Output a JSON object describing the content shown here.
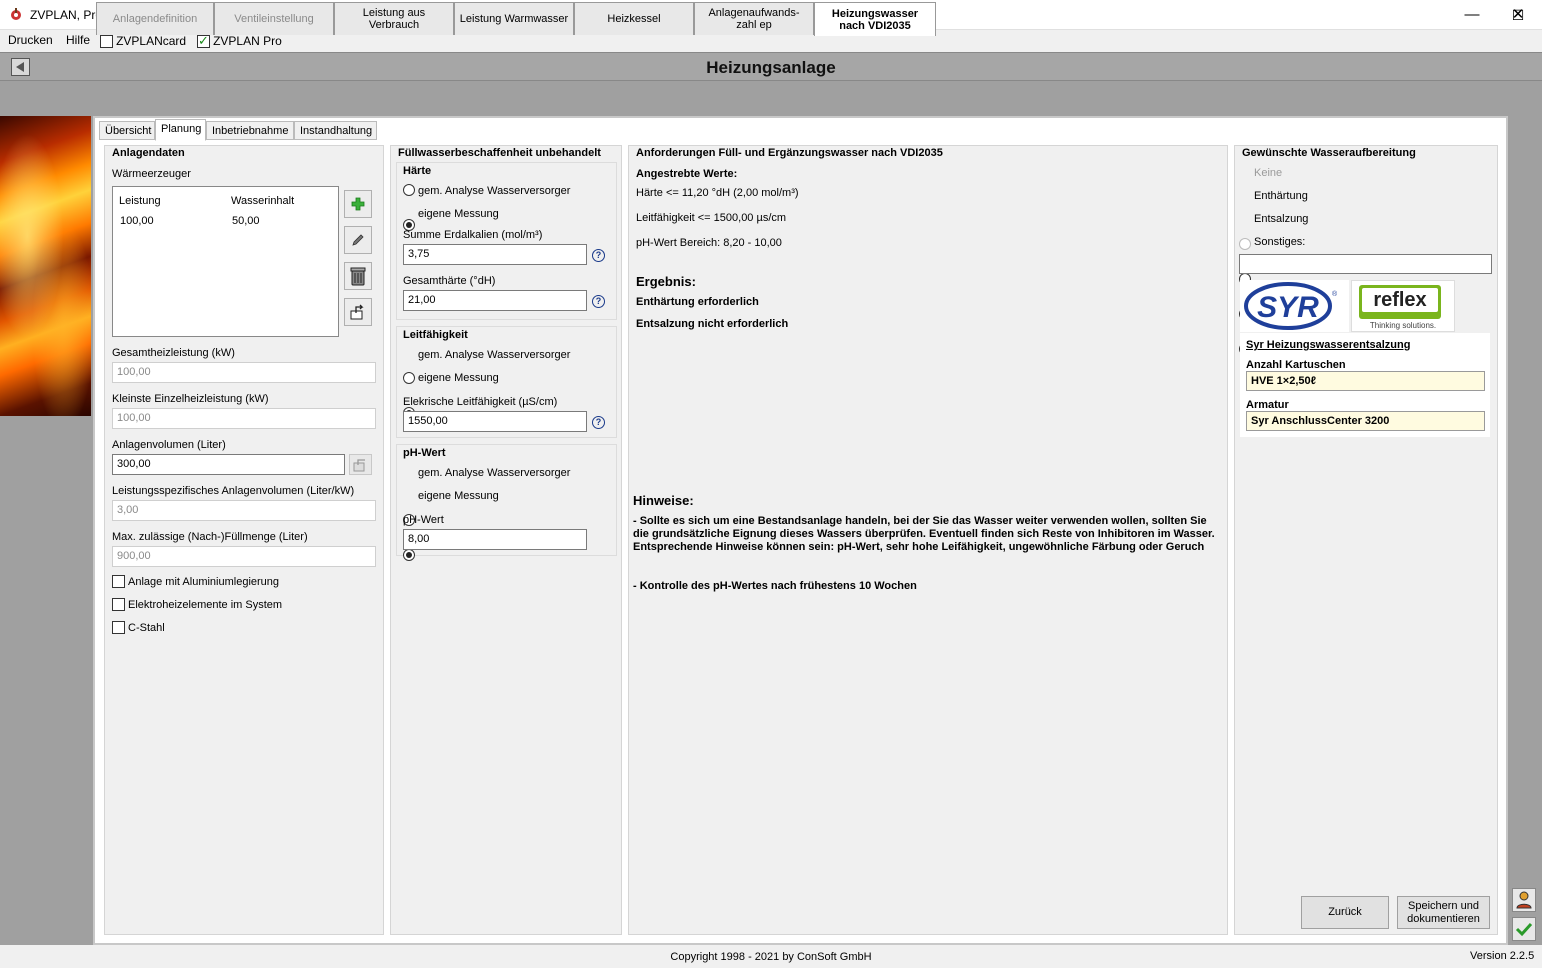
{
  "window": {
    "title": "ZVPLAN, Projekt",
    "minimize": "—",
    "maximize": "☐",
    "close": "✕"
  },
  "menu": {
    "drucken": "Drucken",
    "hilfe": "Hilfe",
    "zvplancard": "ZVPLANcard",
    "zvplanpro": "ZVPLAN Pro"
  },
  "header": {
    "title": "Heizungsanlage"
  },
  "main_tabs": [
    "Anlagendefinition",
    "Ventileinstellung",
    "Leistung aus Verbrauch",
    "Leistung Warmwasser",
    "Heizkessel",
    "Anlagenaufwands- zahl ep",
    "Heizungswasser nach VDI2035"
  ],
  "sub_tabs": [
    "Übersicht",
    "Planung",
    "Inbetriebnahme",
    "Instandhaltung"
  ],
  "anlagendaten": {
    "title": "Anlagendaten",
    "waermeerzeuger": "Wärmeerzeuger",
    "col_leistung": "Leistung",
    "col_wasserinhalt": "Wasserinhalt",
    "row_leistung": "100,00",
    "row_wasserinhalt": "50,00",
    "gesamtheizleistung_label": "Gesamtheizleistung (kW)",
    "gesamtheizleistung": "100,00",
    "kleinste_label": "Kleinste Einzelheizleistung (kW)",
    "kleinste": "100,00",
    "anlagenvolumen_label": "Anlagenvolumen (Liter)",
    "anlagenvolumen": "300,00",
    "leistungsspez_label": "Leistungsspezifisches Anlagenvolumen (Liter/kW)",
    "leistungsspez": "3,00",
    "maxfuell_label": "Max. zulässige (Nach-)Füllmenge (Liter)",
    "maxfuell": "900,00",
    "cb_alu": "Anlage mit Aluminiumlegierung",
    "cb_elektro": "Elektroheizelemente im System",
    "cb_cstahl": "C-Stahl"
  },
  "fuellwasser": {
    "title": "Füllwasserbeschaffenheit unbehandelt",
    "haerte_title": "Härte",
    "r_analyse": "gem. Analyse Wasserversorger",
    "r_eigene": "eigene Messung",
    "erdalkalien_label": "Summe Erdalkalien (mol/m³)",
    "erdalkalien": "3,75",
    "gesamthaerte_label": "Gesamthärte (°dH)",
    "gesamthaerte": "21,00",
    "leit_title": "Leitfähigkeit",
    "leit_label": "Elekrische Leitfähigkeit (µS/cm)",
    "leit": "1550,00",
    "ph_title": "pH-Wert",
    "ph_label": "pH-Wert",
    "ph": "8,00",
    "help": "?"
  },
  "anforderungen": {
    "title": "Anforderungen Füll- und Ergänzungswasser nach VDI2035",
    "angestrebte": "Angestrebte Werte:",
    "haerte": "Härte <= 11,20 °dH (2,00 mol/m³)",
    "leit": "Leitfähigkeit <= 1500,00 µs/cm",
    "ph": "pH-Wert Bereich: 8,20 - 10,00",
    "ergebnis_title": "Ergebnis:",
    "ergebnis1": "Enthärtung erforderlich",
    "ergebnis2": "Entsalzung nicht erforderlich",
    "hinweise_title": "Hinweise:",
    "hinweis1": "- Sollte es sich um eine Bestandsanlage handeln, bei der Sie das Wasser weiter verwenden wollen, sollten Sie die grundsätzliche Eignung dieses Wassers überprüfen. Eventuell finden sich Reste von Inhibitoren im Wasser. Entsprechende Hinweise können sein: pH-Wert, sehr hohe Leifähigkeit, ungewöhnliche Färbung oder Geruch",
    "hinweis2": "- Kontrolle des pH-Wertes nach frühestens 10 Wochen"
  },
  "aufbereitung": {
    "title": "Gewünschte Wasseraufbereitung",
    "keine": "Keine",
    "enthaertung": "Enthärtung",
    "entsalzung": "Entsalzung",
    "sonstiges": "Sonstiges:",
    "syr_logo": "SYR",
    "reflex_logo": "reflex",
    "reflex_tag": "Thinking solutions.",
    "product_title": "Syr Heizungswasserentsalzung",
    "kartuschen_label": "Anzahl Kartuschen",
    "kartuschen": "HVE 1×2,50ℓ",
    "armatur_label": "Armatur",
    "armatur": "Syr AnschlussCenter 3200"
  },
  "buttons": {
    "zurueck": "Zurück",
    "speichern": "Speichern und dokumentieren"
  },
  "status": {
    "copyright": "Copyright 1998 - 2021 by ConSoft GmbH",
    "version": "Version 2.2.5"
  },
  "icons": [
    "app-icon",
    "add-icon",
    "edit-icon",
    "trash-icon",
    "export-icon",
    "copy-icon",
    "user-alert-icon",
    "check-icon",
    "help-icon"
  ],
  "colors": {
    "banner": "#a6a6a6",
    "highlight_field": "#fffbe0",
    "reflex_green": "#7ab51d",
    "syr_blue": "#1f3f9a"
  }
}
